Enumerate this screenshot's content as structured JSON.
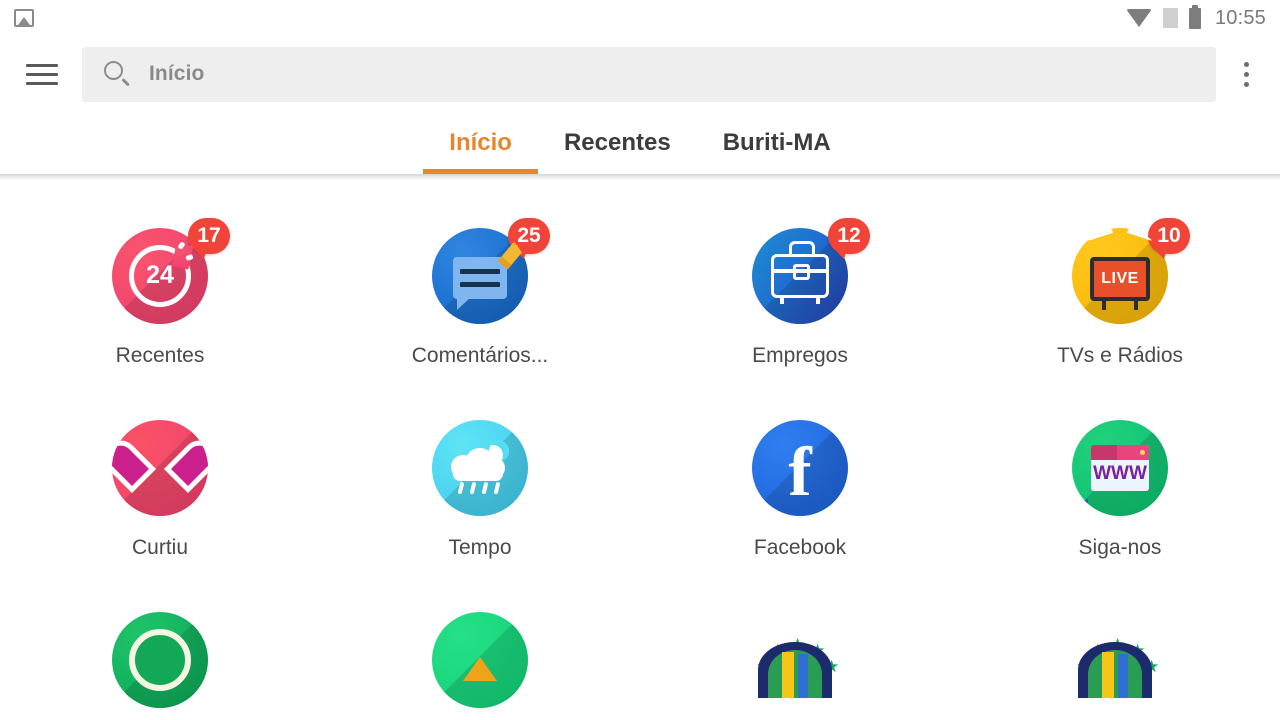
{
  "status_bar": {
    "photo_icon": "image-icon",
    "wifi_icon": "wifi-icon",
    "sim_icon": "sim-card-off-icon",
    "battery_icon": "battery-icon",
    "time": "10:55"
  },
  "toolbar": {
    "menu_icon": "hamburger-menu-icon",
    "search": {
      "icon": "search-icon",
      "value": "Início",
      "placeholder": "Início"
    },
    "overflow_icon": "more-vertical-icon"
  },
  "tabs": {
    "active_index": 0,
    "accent_color": "#e8862a",
    "items": [
      {
        "label": "Início"
      },
      {
        "label": "Recentes"
      },
      {
        "label": "Buriti-MA"
      }
    ]
  },
  "grid": {
    "badge_color": "#f04438",
    "items": [
      {
        "label": "Recentes",
        "icon": "clock-24h-icon",
        "badge": "17",
        "color": "#ef3e70"
      },
      {
        "label": "Comentários...",
        "icon": "comment-edit-icon",
        "badge": "25",
        "color": "#1163c7"
      },
      {
        "label": "Empregos",
        "icon": "briefcase-icon",
        "badge": "12",
        "color": "#2a3fb8"
      },
      {
        "label": "TVs e Rádios",
        "icon": "tv-live-icon",
        "badge": "10",
        "color": "#f7b500"
      },
      {
        "label": "Curtiu",
        "icon": "heart-icon",
        "badge": "",
        "color": "#ef3f6e"
      },
      {
        "label": "Tempo",
        "icon": "weather-rain-night-icon",
        "badge": "",
        "color": "#3dc8ee"
      },
      {
        "label": "Facebook",
        "icon": "facebook-icon",
        "badge": "",
        "color": "#1b5fd8"
      },
      {
        "label": "Siga-nos",
        "icon": "www-browser-icon",
        "badge": "",
        "color": "#0ac071"
      }
    ],
    "partial_row": [
      {
        "icon": "green-ring-icon",
        "color": "#0aa455"
      },
      {
        "icon": "green-star-icon",
        "color": "#11cf76"
      },
      {
        "icon": "brazil-crest-icon",
        "color": "#1b2b6b"
      },
      {
        "icon": "brazil-crest-icon",
        "color": "#1b2b6b"
      }
    ]
  },
  "icon_text": {
    "clock_24": "24",
    "tv_live": "LIVE",
    "facebook_letter": "f",
    "www": "WWW"
  }
}
